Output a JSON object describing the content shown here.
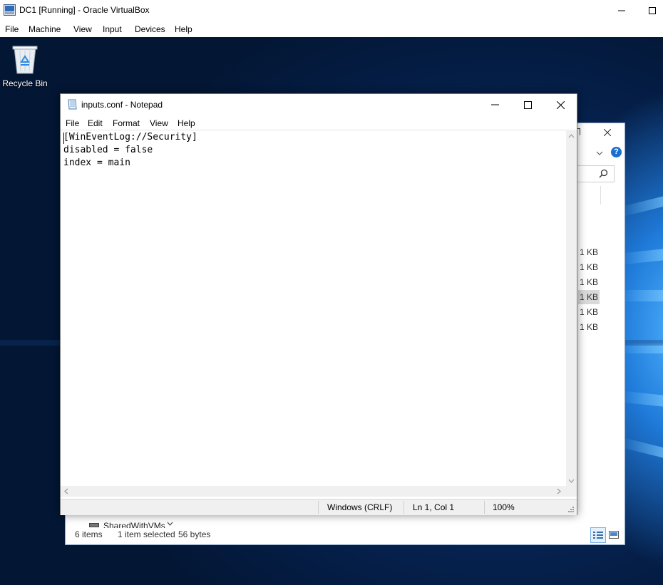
{
  "vbox": {
    "title": "DC1 [Running] - Oracle VirtualBox",
    "menu": [
      "File",
      "Machine",
      "View",
      "Input",
      "Devices",
      "Help"
    ]
  },
  "desktop": {
    "recycle_bin_label": "Recycle Bin"
  },
  "explorer": {
    "sizes": [
      "1 KB",
      "1 KB",
      "1 KB",
      "1 KB",
      "1 KB",
      "1 KB"
    ],
    "selected_index": 3,
    "nav_item": "SharedWithVMs",
    "status": {
      "items": "6 items",
      "selected": "1 item selected",
      "bytes": "56 bytes"
    }
  },
  "notepad": {
    "title": "inputs.conf - Notepad",
    "menu": [
      "File",
      "Edit",
      "Format",
      "View",
      "Help"
    ],
    "lines": [
      "[WinEventLog://Security]",
      "disabled = false",
      "index = main"
    ],
    "status": {
      "eol": "Windows (CRLF)",
      "position": "Ln 1, Col 1",
      "zoom": "100%"
    }
  },
  "colors": {
    "desktop_dark": "#062352",
    "desktop_accent": "#4fb3ff",
    "help_icon": "#1a6fd1",
    "selection": "#d9d9d9"
  }
}
